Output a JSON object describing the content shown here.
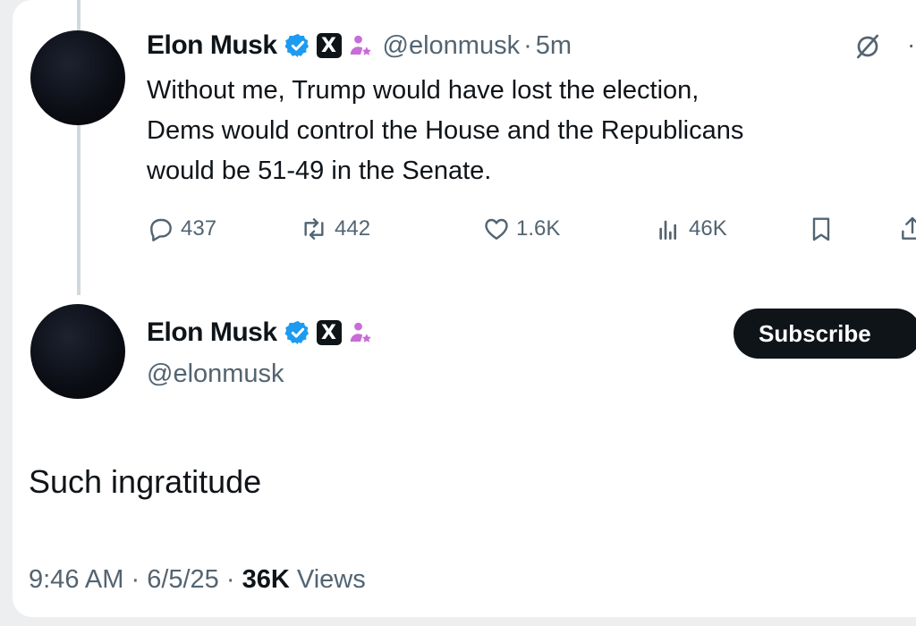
{
  "quoted_tweet": {
    "author_name": "Elon Musk",
    "handle": "@elonmusk",
    "time": "5m",
    "text_lines": [
      "Without me, Trump would have lost the election,",
      "Dems would control the House and the Republicans",
      "would be 51-49 in the Senate."
    ],
    "stats": {
      "replies": "437",
      "reposts": "442",
      "likes": "1.6K",
      "views": "46K"
    },
    "icons": [
      "verified-icon",
      "x-badge-icon",
      "government-badge-icon",
      "grok-icon",
      "more-icon",
      "reply-icon",
      "repost-icon",
      "like-icon",
      "views-icon",
      "bookmark-icon",
      "share-icon"
    ]
  },
  "main_tweet": {
    "author_name": "Elon Musk",
    "handle": "@elonmusk",
    "subscribe_label": "Subscribe",
    "text": "Such ingratitude",
    "time": "9:46 AM",
    "date": "6/5/25",
    "views_count": "36K",
    "views_label": "Views"
  },
  "colors": {
    "text": "#0f1419",
    "secondary": "#536471",
    "verified": "#1d9bf0",
    "badge_purple": "#c86dd7",
    "button_bg": "#0f1419"
  }
}
